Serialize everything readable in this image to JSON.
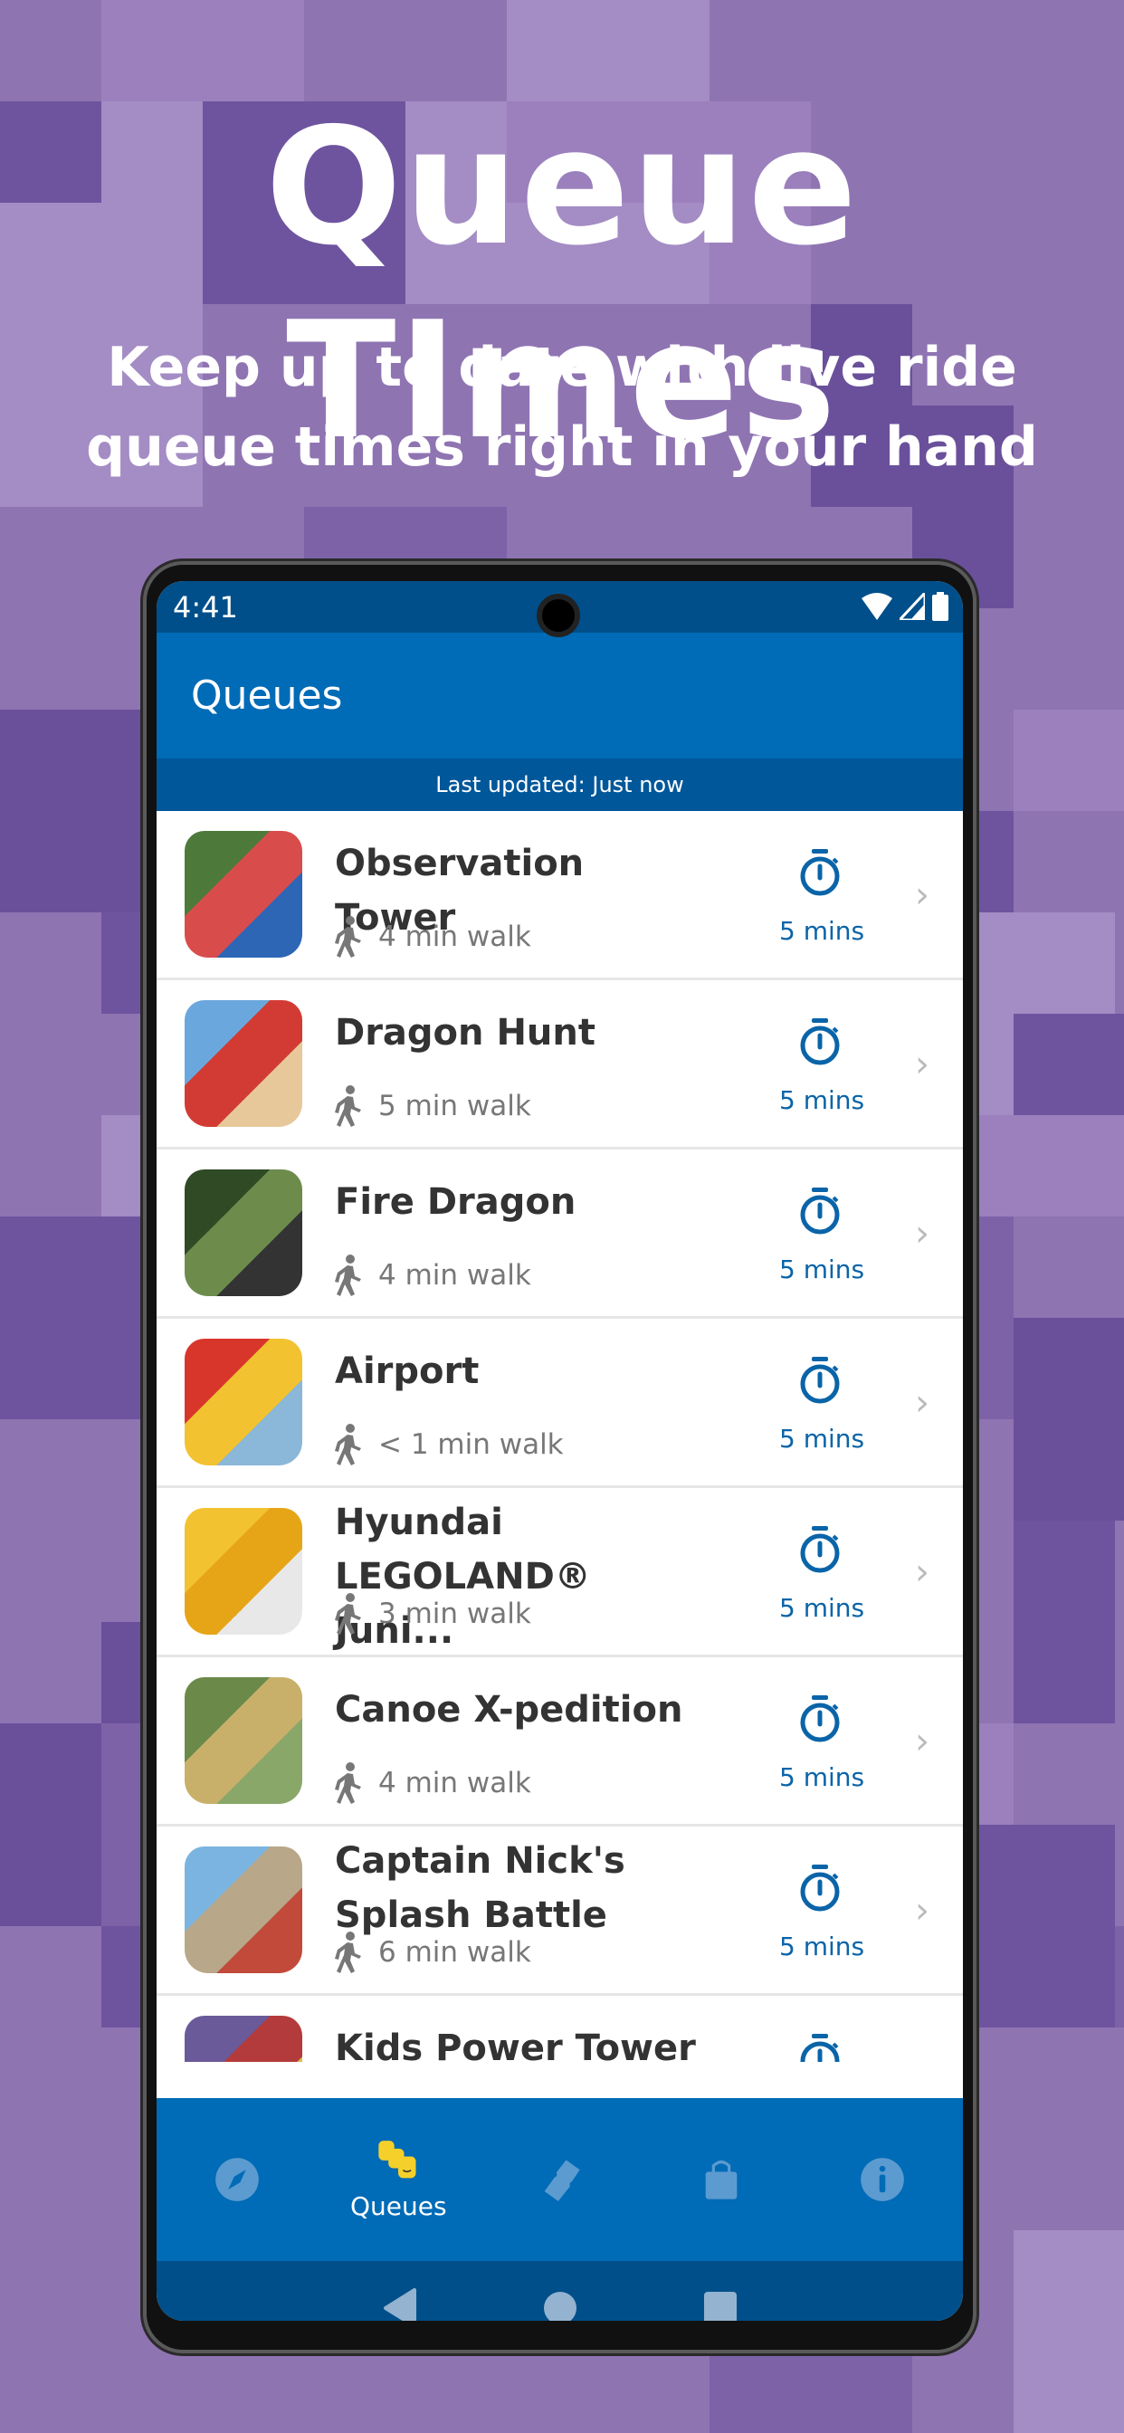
{
  "hero": {
    "title": "Queue TImes",
    "subtitle_line1": "Keep up to date with live ride",
    "subtitle_line2": "queue times right in your hand"
  },
  "status_bar": {
    "time": "4:41",
    "icons": [
      "wifi-icon",
      "signal-icon",
      "battery-icon"
    ]
  },
  "app_bar": {
    "title": "Queues"
  },
  "last_updated": "Last updated: Just now",
  "rides": [
    {
      "name": "Observation Tower",
      "walk": "4 min walk",
      "wait": "5 mins",
      "colors": [
        "#4d7a3a",
        "#d94c4c",
        "#2d66b5"
      ]
    },
    {
      "name": "Dragon Hunt",
      "walk": "5 min walk",
      "wait": "5 mins",
      "colors": [
        "#6aa7dd",
        "#d23b33",
        "#e7c89a"
      ]
    },
    {
      "name": "Fire Dragon",
      "walk": "4 min walk",
      "wait": "5 mins",
      "colors": [
        "#2f4a25",
        "#6d8c4c",
        "#333"
      ]
    },
    {
      "name": "Airport",
      "walk": "< 1 min walk",
      "wait": "5 mins",
      "colors": [
        "#d8362b",
        "#f2c230",
        "#8bb7d8"
      ]
    },
    {
      "name": "Hyundai LEGOLAND® Juni...",
      "walk": "3 min walk",
      "wait": "5 mins",
      "colors": [
        "#f2c230",
        "#e6a517",
        "#e8e8e8"
      ]
    },
    {
      "name": "Canoe X-pedition",
      "walk": "4 min walk",
      "wait": "5 mins",
      "colors": [
        "#6b8a4a",
        "#c9b06a",
        "#8aa76a"
      ]
    },
    {
      "name": "Captain Nick's Splash Battle",
      "walk": "6 min walk",
      "wait": "5 mins",
      "colors": [
        "#7bb4e0",
        "#b9a789",
        "#c24a3a"
      ]
    },
    {
      "name": "Kids Power Tower",
      "walk": "",
      "wait": "",
      "colors": [
        "#6a5a9a",
        "#b33b3b",
        "#d9c04a"
      ]
    }
  ],
  "bottom_nav": [
    {
      "icon": "compass-icon",
      "label": ""
    },
    {
      "icon": "lego-heads-icon",
      "label": "Queues",
      "active": true
    },
    {
      "icon": "ticket-icon",
      "label": ""
    },
    {
      "icon": "shopping-bag-icon",
      "label": ""
    },
    {
      "icon": "info-icon",
      "label": ""
    }
  ],
  "colors": {
    "background": "#8f74b2",
    "primary": "#006bb6",
    "primary_dark": "#004f8a",
    "accent_text": "#0a64a8"
  }
}
